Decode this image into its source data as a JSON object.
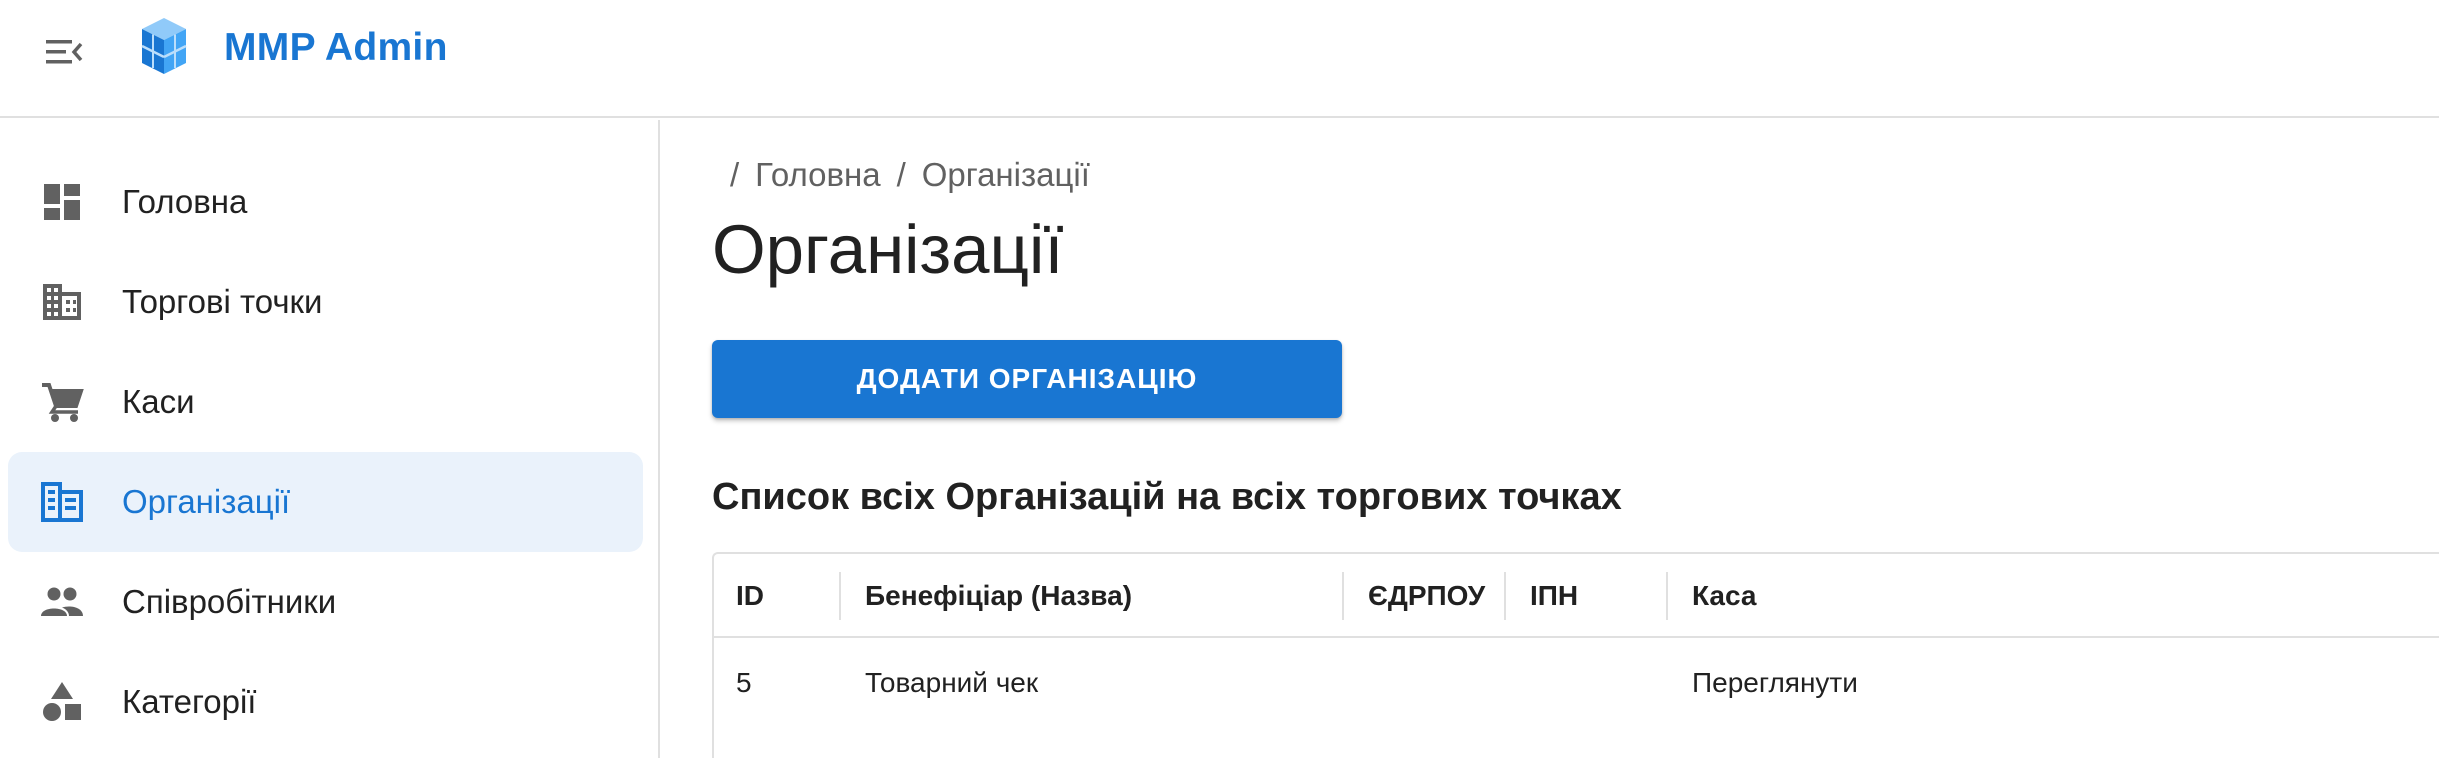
{
  "app": {
    "title": "MMP Admin",
    "accent_color": "#1976d2",
    "menu_icon": "menu-open-icon",
    "logo_icon": "cubes-logo-icon"
  },
  "sidebar": {
    "items": [
      {
        "label": "Головна",
        "icon": "dashboard-icon",
        "active": false
      },
      {
        "label": "Торгові точки",
        "icon": "building-icon",
        "active": false
      },
      {
        "label": "Каси",
        "icon": "cart-icon",
        "active": false
      },
      {
        "label": "Організації",
        "icon": "organization-icon",
        "active": true
      },
      {
        "label": "Співробітники",
        "icon": "people-icon",
        "active": false
      },
      {
        "label": "Категорії",
        "icon": "category-shapes-icon",
        "active": false
      }
    ]
  },
  "breadcrumb": {
    "separator": "/",
    "items": [
      "Головна",
      "Організації"
    ]
  },
  "page": {
    "title": "Організації",
    "add_button_label": "ДОДАТИ ОРГАНІЗАЦІЮ",
    "section_title": "Список всіх Організацій на всіх торгових точках"
  },
  "table": {
    "columns": [
      "ID",
      "Бенефіціар (Назва)",
      "ЄДРПОУ",
      "ІПН",
      "Каса"
    ],
    "rows": [
      {
        "id": "5",
        "name": "Товарний чек",
        "edrpou": "",
        "ipn": "",
        "kasa": "Переглянути"
      }
    ]
  }
}
